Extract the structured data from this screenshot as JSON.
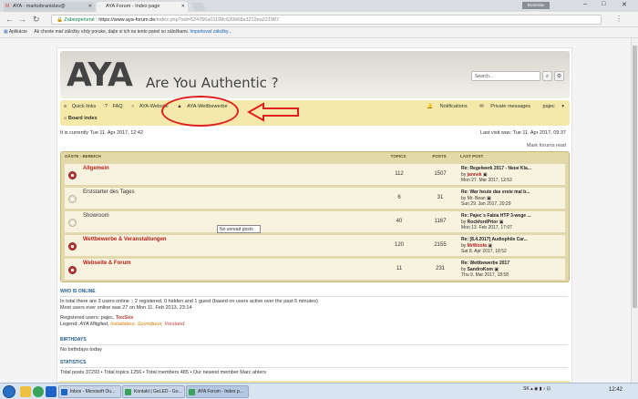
{
  "browser": {
    "tabs": [
      {
        "label": "AYA - markobranislav@",
        "icon": "gmail-icon"
      },
      {
        "label": "AYA Forum - Index page",
        "icon": "page-icon"
      }
    ],
    "user_badge": "Branislav Marko",
    "address": {
      "secure": "Zabezpečené",
      "host": "https://www.aya-forum.de",
      "rest": "/index.php?sid=524756a01198c620b68a3212ea221987"
    },
    "bookmarks_label": "Aplikácie",
    "bookmarks_hint": "Ak chcete mať záložky vždy poruke, dajte si ich na tento panel so záložkami.",
    "bookmarks_link": "Importovať záložky..."
  },
  "forum": {
    "logo": "AYA",
    "tagline": "Are You Authentic ?",
    "search_placeholder": "Search...",
    "nav": {
      "quick": "Quick links",
      "faq": "FAQ",
      "website": "AYA-Website",
      "contests": "AYA-Wettbewerbe",
      "notifications": "Notifications",
      "pm": "Private messages",
      "user": "pajec"
    },
    "board_index": "Board index",
    "current_time": "It is currently Tue 11. Apr 2017, 12:42",
    "last_visit": "Last visit was: Tue 11. Apr 2017, 09:37",
    "mark_read": "Mark forums read",
    "table_head": {
      "forum": "GÄSTE - BEREICH",
      "topics": "TOPICS",
      "posts": "POSTS",
      "last": "LAST POST"
    },
    "forums": [
      {
        "name": "Allgemein",
        "topics": "112",
        "posts": "1507",
        "lp_title": "Re: Regelwerk 2017 - Neue Kla...",
        "lp_by": "by",
        "lp_user": "jannek",
        "lp_date": "Mon 27. Mar 2017, 12:52"
      },
      {
        "name": "Erststarter des Tages",
        "topics": "6",
        "posts": "31",
        "lp_title": "Re: War heute das erste mal b...",
        "lp_by": "by",
        "lp_user": "Mr. Bean",
        "lp_date": "Sun 29. Jan 2017, 20:29"
      },
      {
        "name": "Showroom",
        "topics": "40",
        "posts": "1167",
        "lp_title": "Re: Pajec`s Fabia HTP 3-wege ...",
        "lp_by": "by",
        "lp_user": "RockfordPrior",
        "lp_date": "Mon 13. Feb 2017, 17:07"
      },
      {
        "name": "Wettbewerbe & Veranstaltungen",
        "topics": "120",
        "posts": "2155",
        "lp_title": "Re: [8.4.2017] Audiophile Car...",
        "lp_by": "by",
        "lp_user": "MrWoofa",
        "lp_date": "Sat 8. Apr 2017, 18:52"
      },
      {
        "name": "Webseite & Forum",
        "topics": "11",
        "posts": "231",
        "lp_title": "Re: Wettbewerbe 2017",
        "lp_by": "by",
        "lp_user": "SandroKom",
        "lp_date": "Thu 9. Mar 2017, 18:58"
      }
    ],
    "tooltip": "No unread posts",
    "who_online": {
      "heading": "WHO IS ONLINE",
      "line1": "In total there are 3 users online :: 2 registered, 0 hidden and 1 guest (based on users active over the past 5 minutes)",
      "line2": "Most users ever online was 27 on Mon 11. Feb 2013, 23:14",
      "registered_prefix": "Registered users: pajec,",
      "registered_user2": "ToxSox",
      "legend_prefix": "Legend:",
      "legend_g1": "AYA Mitglied,",
      "legend_g2": "Installateur,",
      "legend_g3": "Soundjuror,",
      "legend_g4": "Vorstand"
    },
    "birthdays": {
      "heading": "BIRTHDAYS",
      "text": "No birthdays today"
    },
    "statistics": {
      "heading": "STATISTICS",
      "text": "Total posts 37293 • Total topics 1256 • Total members 485 • Our newest member Marc ahlers"
    }
  },
  "taskbar": {
    "items": [
      "Inbox - Microsoft Ou...",
      "Kontakt | GeLED - Go...",
      "AYA Forum - Index p..."
    ],
    "tray": "SK",
    "clock": "12:42"
  },
  "colors": {
    "accent": "#b81e1e",
    "nav": "#f4e9a8",
    "annotation": "#e02020"
  }
}
